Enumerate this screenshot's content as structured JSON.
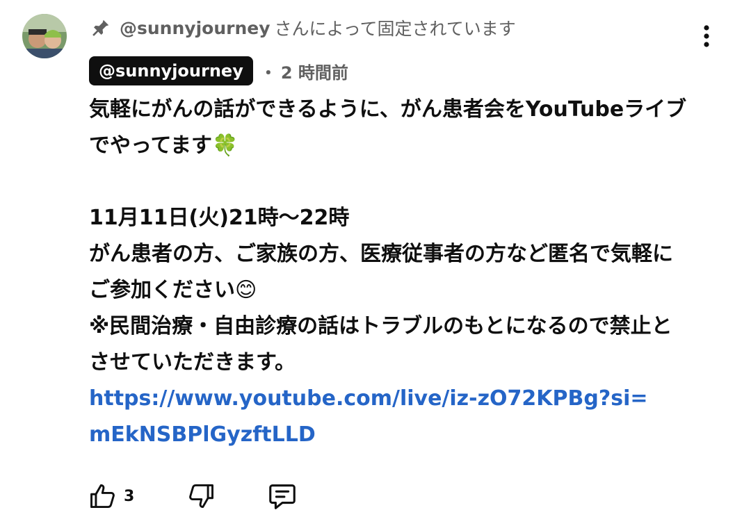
{
  "comment": {
    "pinned_by": "@sunnyjourney",
    "pinned_suffix": "さんによって固定されています",
    "author": "@sunnyjourney",
    "separator": "・",
    "time": "2 時間前",
    "body_lines": [
      "気軽にがんの話ができるように、がん患者会をYouTubeライブ",
      "でやってます",
      "11月11日(火)21時〜22時",
      "がん患者の方、ご家族の方、医療従事者の方など匿名で気軽に",
      "ご参加ください",
      "※民間治療・自由診療の話はトラブルのもとになるので禁止と",
      "させていただきます。"
    ],
    "emoji_clover": "🍀",
    "emoji_smile": "😊",
    "link_lines": [
      "https://www.youtube.com/live/iz-zO72KPBg?si=",
      "mEkNSBPlGyzftLLD"
    ],
    "like_count": "3"
  },
  "icons": {
    "pin": "pin-icon",
    "more": "more-vertical-icon",
    "like": "thumbs-up-icon",
    "dislike": "thumbs-down-icon",
    "reply": "reply-icon"
  },
  "colors": {
    "link": "#2565c7",
    "muted": "#606060",
    "chip_bg": "#0f0f0f"
  }
}
